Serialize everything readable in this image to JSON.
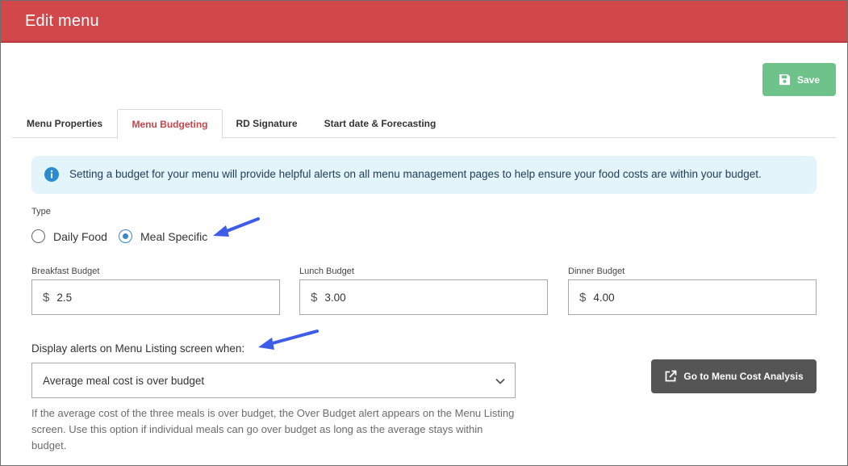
{
  "header": {
    "title": "Edit menu",
    "color": "#d1474a"
  },
  "toolbar": {
    "save_label": "Save",
    "save_icon": "floppy-disk-icon",
    "save_color": "#6dc38a"
  },
  "tabs": [
    {
      "label": "Menu Properties",
      "active": false
    },
    {
      "label": "Menu Budgeting",
      "active": true
    },
    {
      "label": "RD Signature",
      "active": false
    },
    {
      "label": "Start date & Forecasting",
      "active": false
    }
  ],
  "info": {
    "icon": "info-circle-icon",
    "text": "Setting a budget for your menu will provide helpful alerts on all menu management pages to help ensure your food costs are within your budget."
  },
  "type": {
    "label": "Type",
    "options": [
      {
        "label": "Daily Food",
        "selected": false
      },
      {
        "label": "Meal Specific",
        "selected": true
      }
    ]
  },
  "budgets": [
    {
      "label": "Breakfast Budget",
      "currency": "$",
      "value": "2.5"
    },
    {
      "label": "Lunch Budget",
      "currency": "$",
      "value": "3.00"
    },
    {
      "label": "Dinner Budget",
      "currency": "$",
      "value": "4.00"
    }
  ],
  "alerts": {
    "label": "Display alerts on Menu Listing screen when:",
    "selected": "Average meal cost is over budget",
    "help": "If the average cost of the three meals is over budget, the Over Budget alert appears on the Menu Listing screen. Use this option if individual meals can go over budget as long as the average stays within budget."
  },
  "analysis_button": {
    "label": "Go to Menu Cost Analysis",
    "icon": "external-link-icon",
    "color": "#555555"
  },
  "annotations": {
    "arrow_color": "#3d5ce8"
  }
}
